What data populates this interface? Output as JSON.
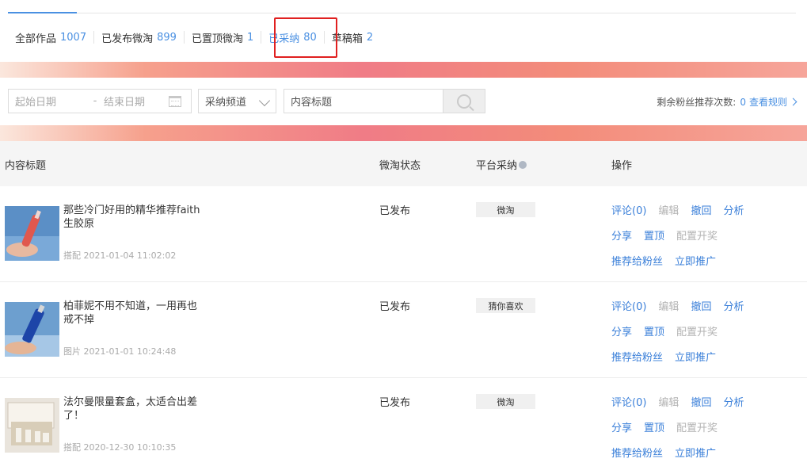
{
  "tabs": [
    {
      "label": "全部作品",
      "count": "1007"
    },
    {
      "label": "已发布微淘",
      "count": "899"
    },
    {
      "label": "已置顶微淘",
      "count": "1"
    },
    {
      "label": "已采纳",
      "count": "80"
    },
    {
      "label": "草稿箱",
      "count": "2"
    }
  ],
  "filter": {
    "start_placeholder": "起始日期",
    "separator": "-",
    "end_placeholder": "结束日期",
    "channel_placeholder": "采纳频道",
    "title_placeholder": "内容标题",
    "remain_label": "剩余粉丝推荐次数:",
    "remain_count": "0",
    "rules_link": "查看规则"
  },
  "table": {
    "headers": {
      "title": "内容标题",
      "status": "微淘状态",
      "platform": "平台采纳",
      "ops": "操作"
    },
    "rows": [
      {
        "title": "那些冷门好用的精华推荐faith生胶原",
        "meta": "搭配 2021-01-04 11:02:02",
        "status": "已发布",
        "platform": "微淘"
      },
      {
        "title": "柏菲妮不用不知道，一用再也戒不掉",
        "meta": "图片 2021-01-01 10:24:48",
        "status": "已发布",
        "platform": "猜你喜欢"
      },
      {
        "title": "法尔曼限量套盒，太适合出差了！",
        "meta": "搭配 2020-12-30 10:10:35",
        "status": "已发布",
        "platform": "微淘"
      }
    ],
    "ops": {
      "comment": "评论(0)",
      "edit": "编辑",
      "withdraw": "撤回",
      "analyze": "分析",
      "share": "分享",
      "pin": "置顶",
      "lottery": "配置开奖",
      "recommend": "推荐给粉丝",
      "promote": "立即推广"
    }
  },
  "colors": {
    "accent": "#4a90e2",
    "highlight": "#e02020"
  }
}
